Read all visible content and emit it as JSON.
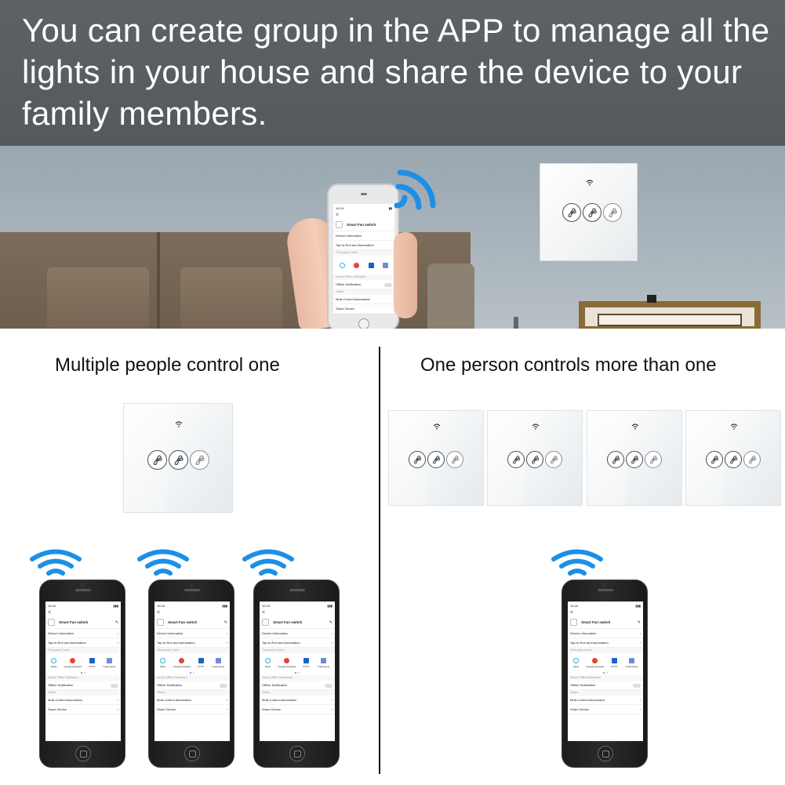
{
  "banner": {
    "text": "You can create group in the APP to manage all the lights in your house and share the device to your family members."
  },
  "sections": {
    "left_title": "Multiple people control one",
    "right_title": "One person controls more than one"
  },
  "app_screen": {
    "time": "16:18",
    "back": "<",
    "device_name": "Smart Fan switch",
    "rows": {
      "device_information": "Device Information",
      "tap_to_run": "Tap-to-Run and Automation",
      "third_party_control": "Third-party Control",
      "offline_section": "Device Offline Notification",
      "offline_notification": "Offline Notification",
      "others": "Others",
      "multi_control": "Multi-Control Association",
      "share_device": "Share Device"
    },
    "third_party": [
      {
        "label": "Alexa",
        "color": "#2bb5e8"
      },
      {
        "label": "Google Assistant",
        "color": "#ea4335"
      },
      {
        "label": "IFTTT",
        "color": "#1f5fc8"
      },
      {
        "label": "Tmall Genie",
        "color": "#6b8fd6"
      }
    ]
  },
  "colors": {
    "banner_bg": "#5a5e62",
    "wifi_blue": "#1d8fe6",
    "divider": "#111111"
  }
}
